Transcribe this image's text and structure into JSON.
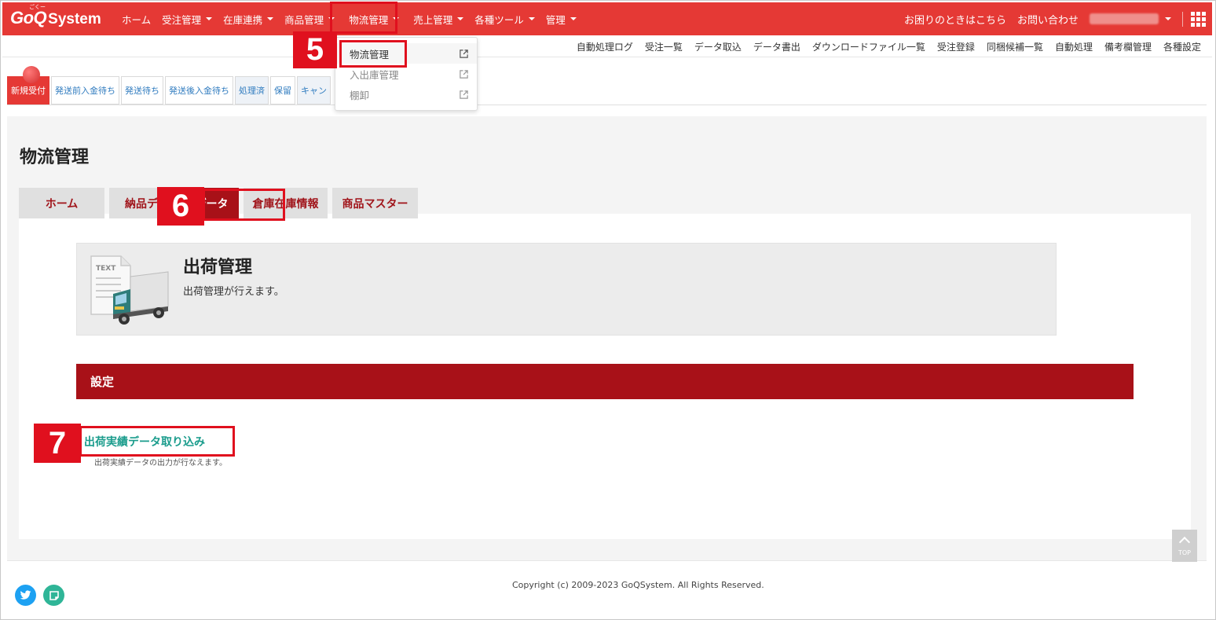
{
  "app": {
    "logo_main": "GoQ",
    "logo_sub": "System",
    "logo_ruby": "ごくー"
  },
  "topnav": {
    "items": [
      {
        "label": "ホーム",
        "caret": false
      },
      {
        "label": "受注管理",
        "caret": true
      },
      {
        "label": "在庫連携",
        "caret": true
      },
      {
        "label": "商品管理",
        "caret": true
      },
      {
        "label": "物流管理",
        "caret": true
      },
      {
        "label": "売上管理",
        "caret": true
      },
      {
        "label": "各種ツール",
        "caret": true
      },
      {
        "label": "管理",
        "caret": true
      }
    ],
    "help": "お困りのときはこちら",
    "contact": "お問い合わせ"
  },
  "subnav": {
    "items": [
      "自動処理ログ",
      "受注一覧",
      "データ取込",
      "データ書出",
      "ダウンロードファイル一覧",
      "受注登録",
      "同梱候補一覧",
      "自動処理",
      "備考欄管理",
      "各種設定"
    ]
  },
  "dropdown": {
    "items": [
      "物流管理",
      "入出庫管理",
      "棚卸"
    ]
  },
  "status_tabs": [
    "新規受付",
    "発送前入金待ち",
    "発送待ち",
    "発送後入金待ち",
    "処理済",
    "保留",
    "キャン"
  ],
  "page": {
    "title": "物流管理",
    "tabs": [
      "ホーム",
      "納品デ",
      "出荷データ",
      "倉庫在庫情報",
      "商品マスター"
    ],
    "hero_title": "出荷管理",
    "hero_desc": "出荷管理が行えます。",
    "hero_img_text": "TEXT",
    "settings_title": "設定",
    "link_title": "出荷実績データ取り込み",
    "link_desc": "出荷実績データの出力が行なえます。"
  },
  "annotations": {
    "step5": "5",
    "step6": "6",
    "step7": "7"
  },
  "footer": {
    "copyright": "Copyright (c) 2009-2023 GoQSystem. All Rights Reserved.",
    "to_top": "TOP"
  },
  "colors": {
    "brand_red": "#e53935",
    "dark_red": "#a81118",
    "annotation_red": "#e0101e",
    "link_teal": "#1a9c8c"
  }
}
